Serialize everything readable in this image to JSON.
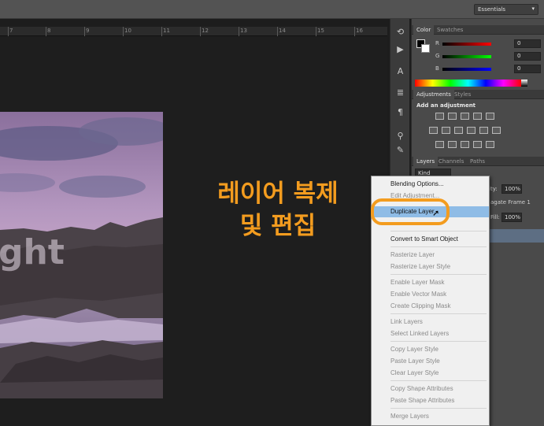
{
  "topbar": {
    "workspace_label": "Essentials"
  },
  "ruler": {
    "numbers": [
      "7",
      "8",
      "9",
      "10",
      "11",
      "12",
      "13",
      "14",
      "15",
      "16"
    ]
  },
  "canvas": {
    "image_text": "ght",
    "caption_line1": "레이어 복제",
    "caption_line2": "및 편집",
    "caption_color": "#f39c1f"
  },
  "color_panel": {
    "tabs": [
      "Color",
      "Swatches"
    ],
    "channels": [
      {
        "label": "R",
        "value": "0"
      },
      {
        "label": "G",
        "value": "0"
      },
      {
        "label": "B",
        "value": "0"
      }
    ]
  },
  "adjustments_panel": {
    "tabs": [
      "Adjustments",
      "Styles"
    ],
    "title": "Add an adjustment"
  },
  "layers_panel": {
    "tabs": [
      "Layers",
      "Channels",
      "Paths"
    ],
    "filter_kind": "Kind",
    "opacity_label": "ity:",
    "opacity_value": "100%",
    "fill_label": "Fill:",
    "fill_value": "100%",
    "layer_name": "agate Frame 1"
  },
  "context_menu": {
    "items": [
      {
        "label": "Blending Options...",
        "enabled": true
      },
      {
        "label": "Edit Adjustment...",
        "enabled": false
      },
      {
        "label": "Duplicate Layer...",
        "enabled": true,
        "highlighted": true
      },
      {
        "label": "Convert to Smart Object",
        "enabled": true
      },
      {
        "label": "Rasterize Layer",
        "enabled": false
      },
      {
        "label": "Rasterize Layer Style",
        "enabled": false
      },
      {
        "label": "Enable Layer Mask",
        "enabled": false
      },
      {
        "label": "Enable Vector Mask",
        "enabled": false
      },
      {
        "label": "Create Clipping Mask",
        "enabled": false
      },
      {
        "label": "Link Layers",
        "enabled": false
      },
      {
        "label": "Select Linked Layers",
        "enabled": false
      },
      {
        "label": "Copy Layer Style",
        "enabled": false
      },
      {
        "label": "Paste Layer Style",
        "enabled": false
      },
      {
        "label": "Clear Layer Style",
        "enabled": false
      },
      {
        "label": "Copy Shape Attributes",
        "enabled": false
      },
      {
        "label": "Paste Shape Attributes",
        "enabled": false
      },
      {
        "label": "Merge Layers",
        "enabled": false
      }
    ]
  }
}
